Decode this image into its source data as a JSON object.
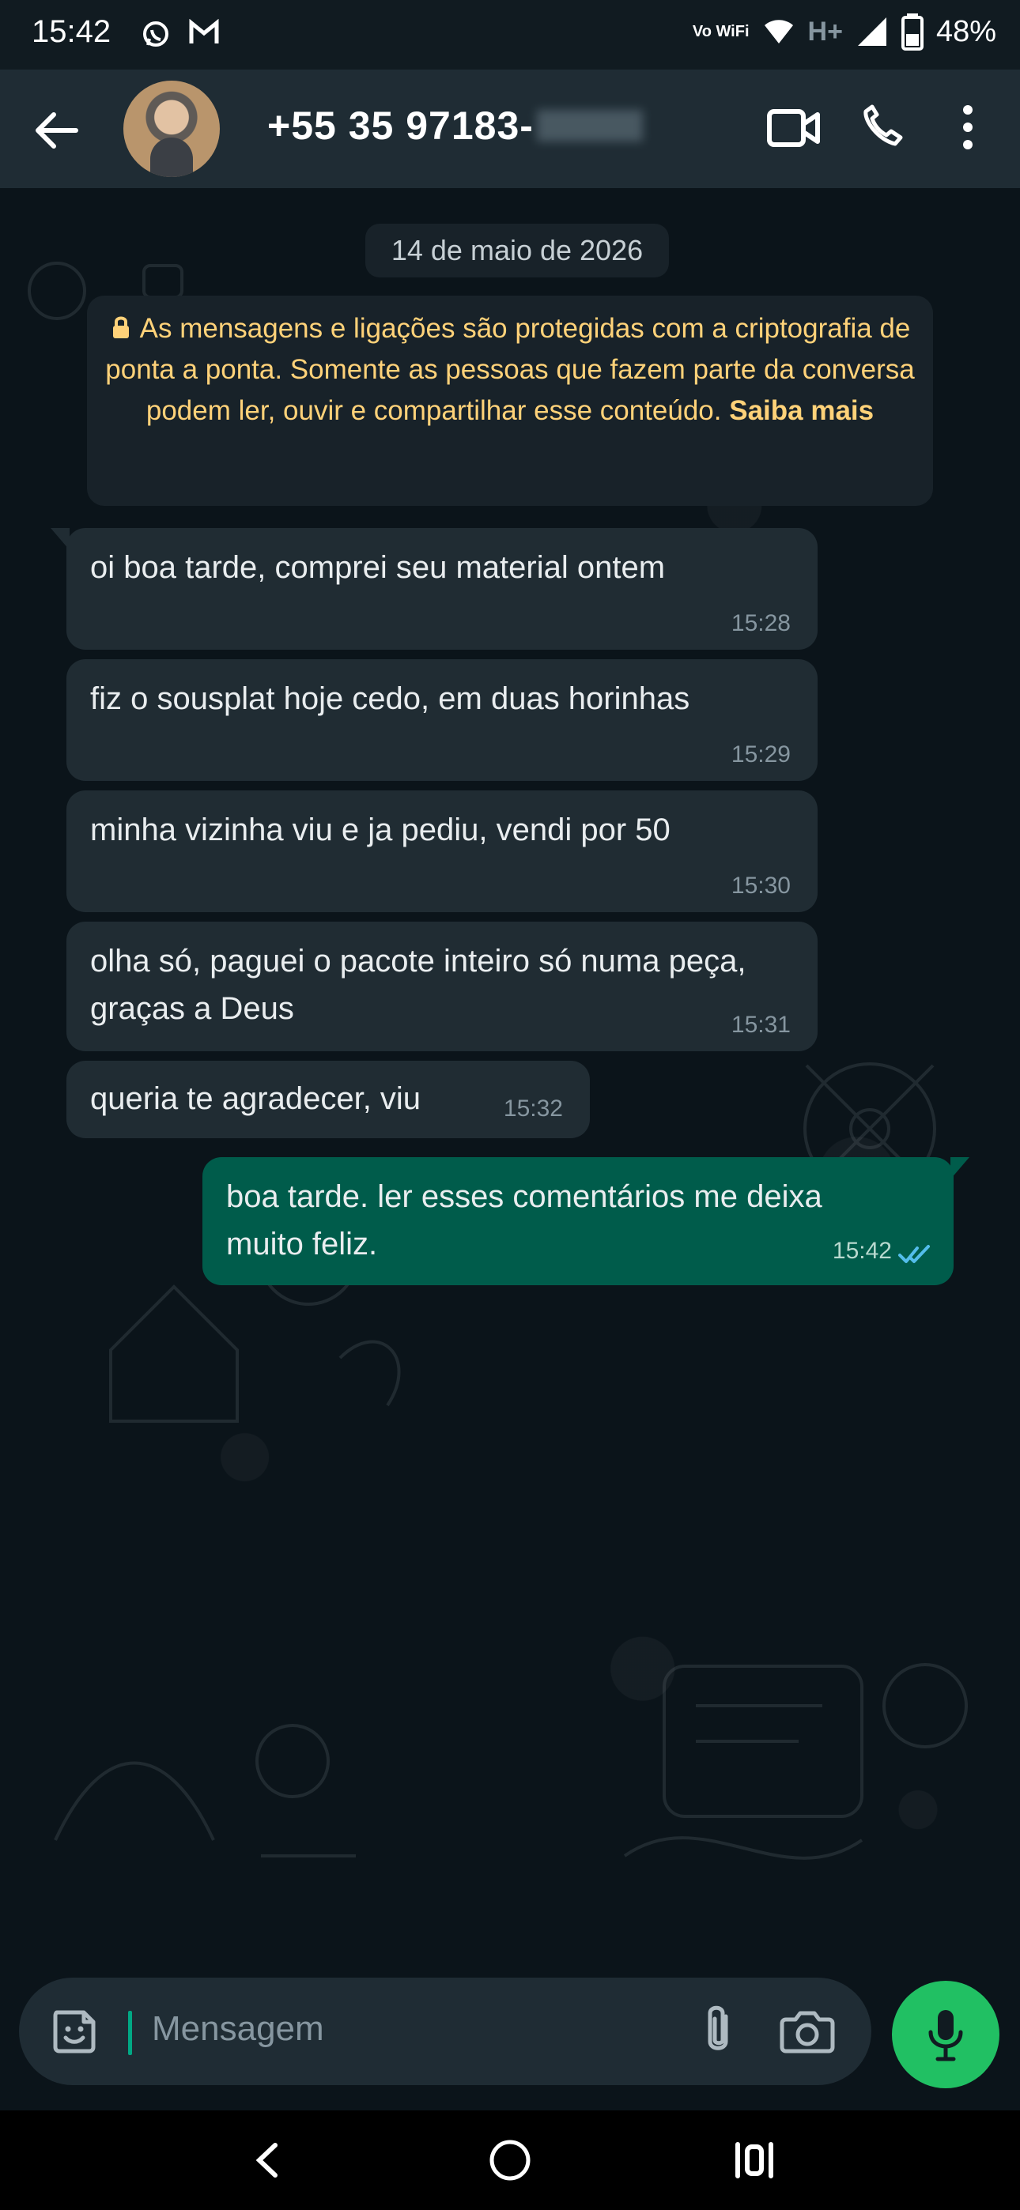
{
  "status_bar": {
    "time": "15:42",
    "left_icons": [
      "whatsapp-icon",
      "gmail-icon"
    ],
    "network": "Vo WiFi",
    "signal_label": "H+",
    "battery": "48%"
  },
  "header": {
    "contact_visible": "+55 35 97183-",
    "icons": [
      "back-arrow-icon",
      "video-call-icon",
      "phone-call-icon",
      "more-options-icon"
    ]
  },
  "chat": {
    "date": "14 de maio de 2026",
    "encryption_notice": "As mensagens e ligações são protegidas com a criptografia de ponta a ponta. Somente as pessoas que fazem parte da conversa podem ler, ouvir e compartilhar esse conteúdo.",
    "encryption_link": "Saiba mais",
    "messages": [
      {
        "direction": "incoming",
        "text": "oi boa tarde, comprei seu material ontem",
        "time": "15:28"
      },
      {
        "direction": "incoming",
        "text": "fiz o sousplat hoje cedo, em duas horinhas",
        "time": "15:29"
      },
      {
        "direction": "incoming",
        "text": "minha vizinha viu e ja pediu, vendi por 50",
        "time": "15:30"
      },
      {
        "direction": "incoming",
        "text": "olha só, paguei o pacote inteiro só numa peça, graças a Deus",
        "time": "15:31"
      },
      {
        "direction": "incoming",
        "text": "queria te agradecer, viu",
        "time": "15:32"
      },
      {
        "direction": "outgoing",
        "text": "boa tarde. ler esses comentários me deixa muito feliz.",
        "time": "15:42",
        "status": "read"
      }
    ]
  },
  "composer": {
    "placeholder": "Mensagem",
    "icons": [
      "sticker-icon",
      "attachment-icon",
      "camera-icon",
      "microphone-icon"
    ]
  },
  "system_nav": {
    "icons": [
      "back-nav-icon",
      "home-nav-icon",
      "recent-apps-icon"
    ]
  },
  "colors": {
    "background": "#0b141a",
    "header": "#1f2c34",
    "incoming_bubble": "#202c33",
    "outgoing_bubble": "#005c4b",
    "accent": "#21c063",
    "encryption_text": "#ffd279"
  }
}
